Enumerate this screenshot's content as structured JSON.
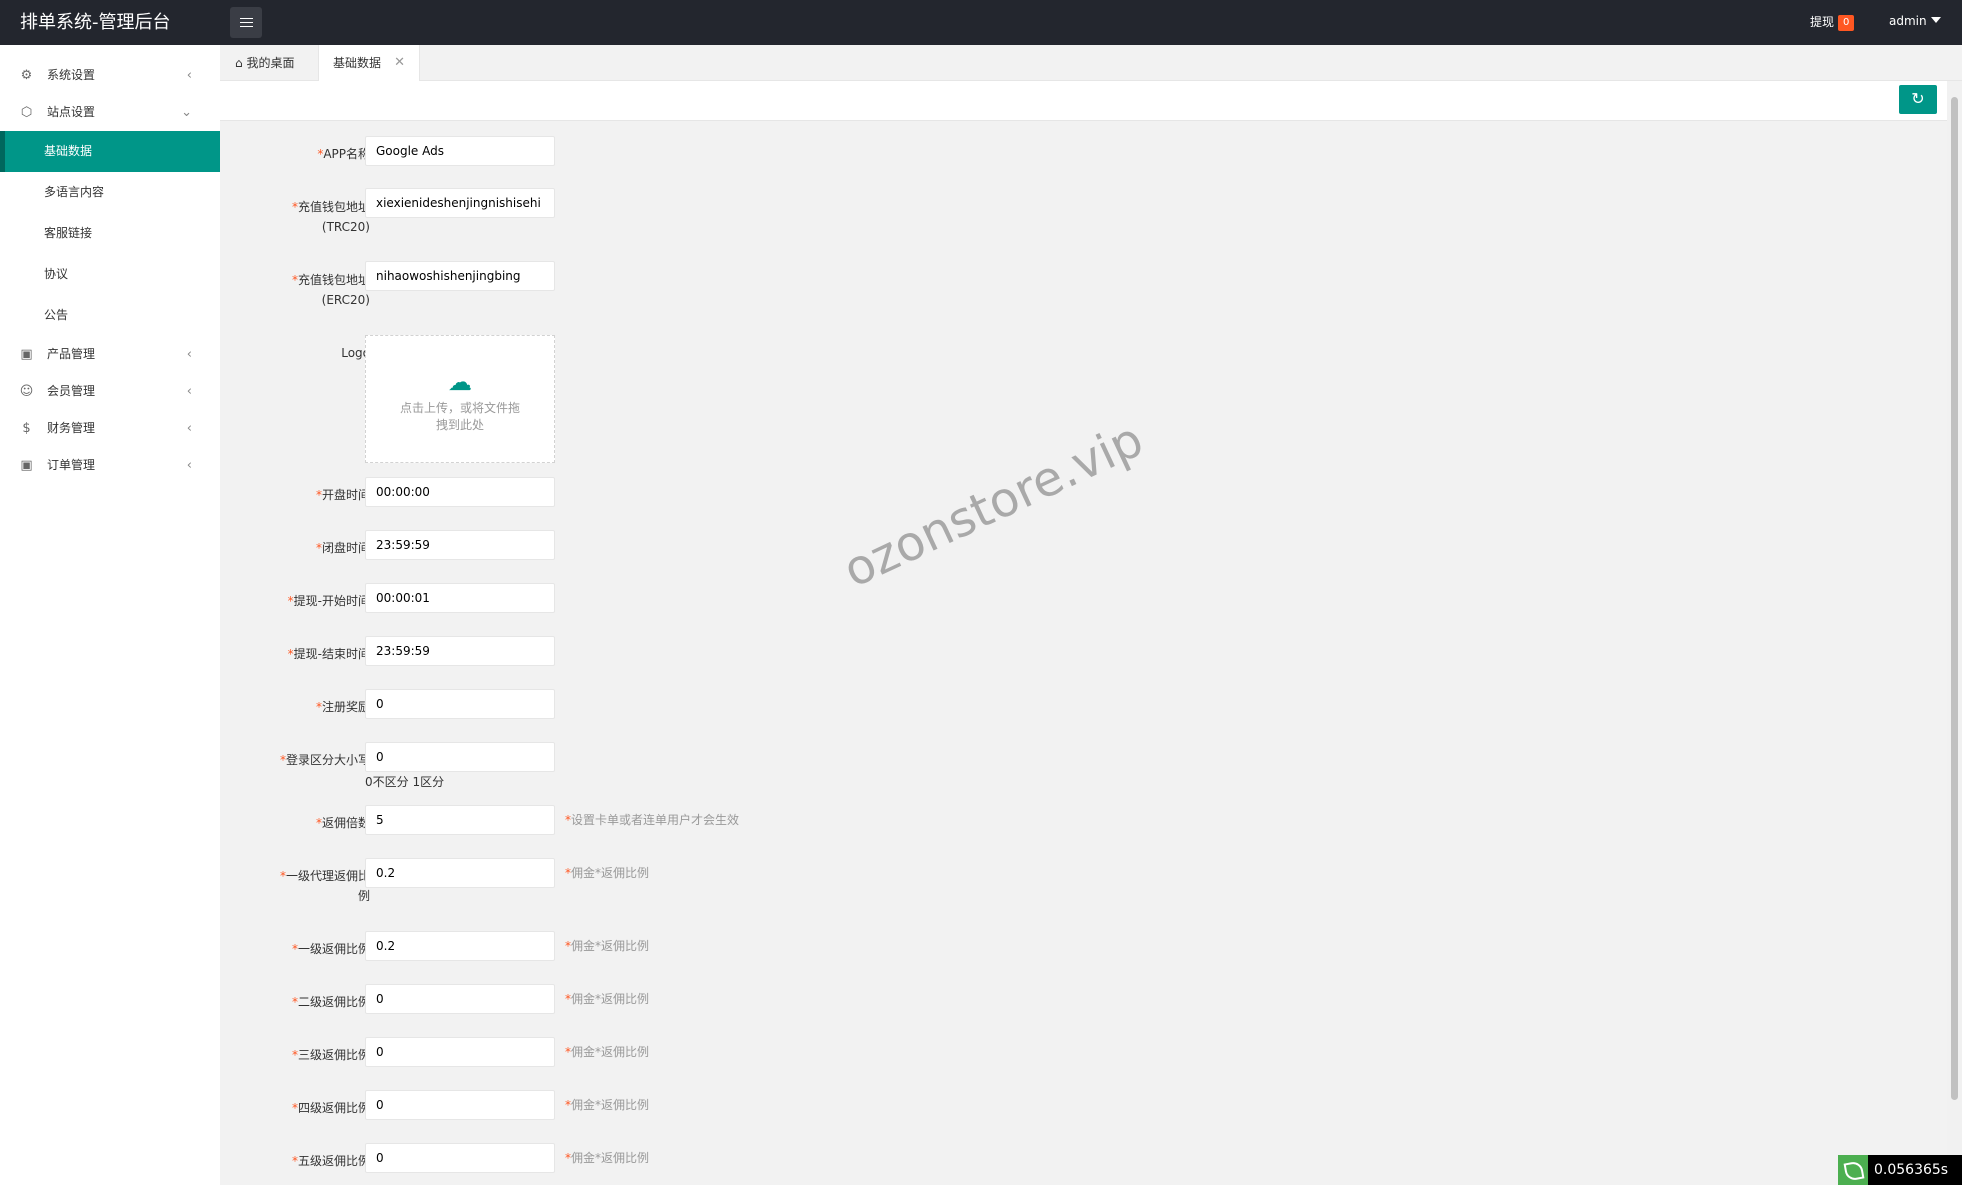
{
  "app_title": "排单系统-管理后台",
  "header": {
    "withdraw_label": "提现",
    "withdraw_count": "0",
    "user": "admin"
  },
  "sidebar": {
    "groups": [
      {
        "label": "系统设置",
        "icon": "gear-icon",
        "expanded": false
      },
      {
        "label": "站点设置",
        "icon": "site-icon",
        "expanded": true
      },
      {
        "label": "产品管理",
        "icon": "box-icon",
        "expanded": false
      },
      {
        "label": "会员管理",
        "icon": "user-icon",
        "expanded": false
      },
      {
        "label": "财务管理",
        "icon": "dollar-icon",
        "expanded": false
      },
      {
        "label": "订单管理",
        "icon": "box-icon",
        "expanded": false
      }
    ],
    "site_items": [
      "基础数据",
      "多语言内容",
      "客服链接",
      "协议",
      "公告"
    ],
    "active_item": "基础数据"
  },
  "tabs": {
    "home": "我的桌面",
    "current": "基础数据"
  },
  "form": {
    "app_name": {
      "label": "APP名称",
      "value": "Google Ads"
    },
    "trc20": {
      "label": "充值钱包地址",
      "label2": "(TRC20)",
      "value": "xiexienideshenjingnishisehi"
    },
    "erc20": {
      "label": "充值钱包地址",
      "label2": "(ERC20)",
      "value": "nihaowoshishenjingbing"
    },
    "logo": {
      "label": "Logo",
      "upload_text": "点击上传，或将文件拖拽到此处"
    },
    "open_time": {
      "label": "开盘时间",
      "value": "00:00:00"
    },
    "close_time": {
      "label": "闭盘时间",
      "value": "23:59:59"
    },
    "withdraw_start": {
      "label": "提现-开始时间",
      "value": "00:00:01"
    },
    "withdraw_end": {
      "label": "提现-结束时间",
      "value": "23:59:59"
    },
    "register_reward": {
      "label": "注册奖励",
      "value": "0"
    },
    "login_case": {
      "label": "登录区分大小写",
      "value": "0",
      "note": "0不区分 1区分"
    },
    "commission_multiple": {
      "label": "返佣倍数",
      "value": "5",
      "hint": "设置卡单或者连单用户才会生效"
    },
    "agent_level1": {
      "label": "一级代理返佣比",
      "label2": "例",
      "value": "0.2",
      "hint": "佣金*返佣比例"
    },
    "level1": {
      "label": "一级返佣比例",
      "value": "0.2",
      "hint": "佣金*返佣比例"
    },
    "level2": {
      "label": "二级返佣比例",
      "value": "0",
      "hint": "佣金*返佣比例"
    },
    "level3": {
      "label": "三级返佣比例",
      "value": "0",
      "hint": "佣金*返佣比例"
    },
    "level4": {
      "label": "四级返佣比例",
      "value": "0",
      "hint": "佣金*返佣比例"
    },
    "level5": {
      "label": "五级返佣比例",
      "value": "0",
      "hint": "佣金*返佣比例"
    }
  },
  "watermark": "ozonstore.vip",
  "timer": "0.056365s",
  "colors": {
    "accent": "#009688",
    "header": "#23262e",
    "badge": "#ff5722"
  }
}
